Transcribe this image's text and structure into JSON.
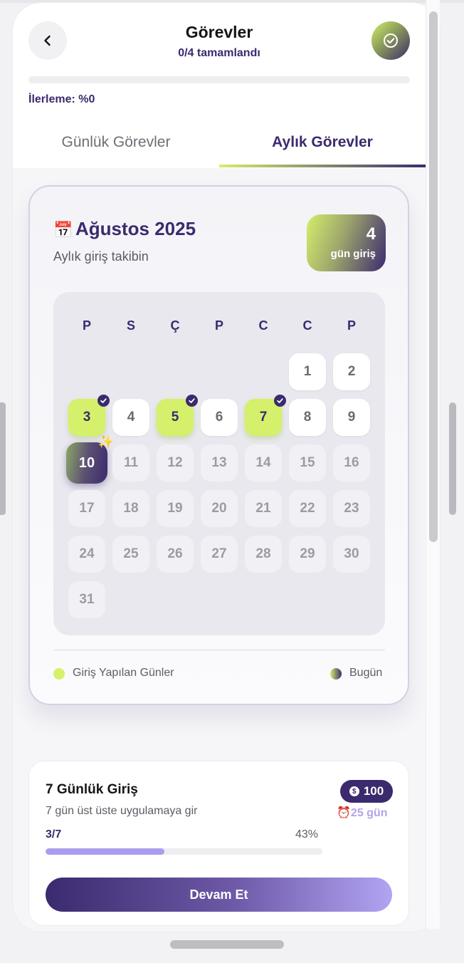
{
  "header": {
    "title": "Görevler",
    "subtitle": "0/4 tamamlandı",
    "progress_label": "İlerleme: %0",
    "progress_fraction": 0,
    "back_icon": "chevron-left-icon",
    "done_icon": "check-circle-icon"
  },
  "tabs": [
    {
      "label": "Günlük Görevler",
      "active": false
    },
    {
      "label": "Aylık Görevler",
      "active": true
    }
  ],
  "calendar": {
    "icon": "📅",
    "month": "Ağustos 2025",
    "subtitle": "Aylık giriş takibin",
    "login_count": "4",
    "login_label": "gün giriş",
    "weekdays": [
      "P",
      "S",
      "Ç",
      "P",
      "C",
      "C",
      "P"
    ],
    "first_weekday_index": 5,
    "days_in_month": 31,
    "today": 10,
    "checked_days": [
      3,
      5,
      7
    ],
    "legend": {
      "logged": "Giriş Yapılan Günler",
      "today": "Bugün"
    }
  },
  "task": {
    "title": "7 Günlük Giriş",
    "description": "7 gün üst üste uygulamaya gir",
    "reward": "100",
    "reward_icon": "coin-icon",
    "deadline_icon": "⏰",
    "deadline": "25 gün",
    "count": "3/7",
    "percent": "43%",
    "progress_fraction": 0.43,
    "button": "Devam Et"
  },
  "colors": {
    "brand": "#3b2a6e",
    "accent": "#d5f06a",
    "soft_purple": "#ab9cf0"
  }
}
